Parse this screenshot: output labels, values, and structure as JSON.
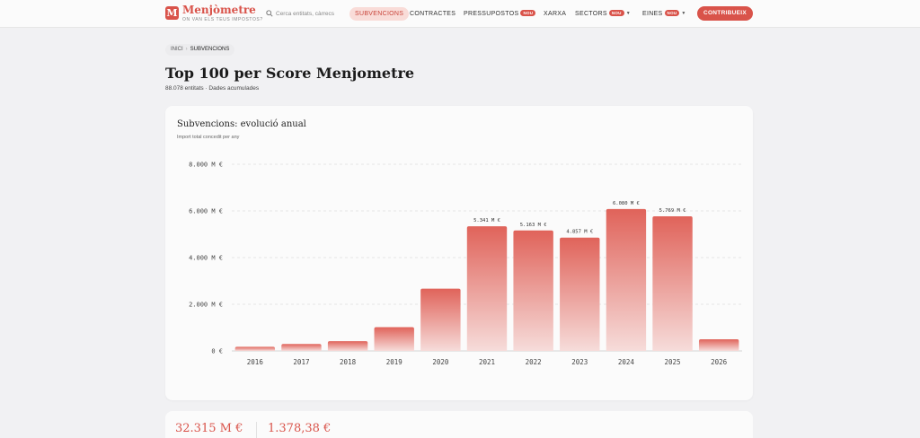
{
  "header": {
    "logo_letter": "M",
    "brand": "Menjòmetre",
    "tagline": "ON VAN ELS TEUS IMPOSTOS?",
    "search_placeholder": "Cerca entitats, càrrecs",
    "nav": [
      {
        "label": "SUBVENCIONS",
        "badge": "",
        "active": true
      },
      {
        "label": "CONTRACTES",
        "badge": ""
      },
      {
        "label": "PRESSUPOSTOS",
        "badge": "NOU"
      },
      {
        "label": "XARXA",
        "badge": ""
      },
      {
        "label": "SECTORS",
        "badge": "NOU",
        "dropdown": true
      },
      {
        "label": "EINES",
        "badge": "NOU",
        "dropdown": true
      }
    ],
    "cta": "CONTRIBUEIX"
  },
  "breadcrumb": {
    "home": "INICI",
    "current": "SUBVENCIONS"
  },
  "page": {
    "title": "Top 100 per Score Menjometre",
    "subtitle": "88.078 entitats · Dades acumulades"
  },
  "chart_card": {
    "title": "Subvencions: evolució anual",
    "subtitle": "Import total concedit per any"
  },
  "chart_data": {
    "type": "bar",
    "title": "Subvencions: evolució anual",
    "subtitle": "Import total concedit per any",
    "categories": [
      "2016",
      "2017",
      "2018",
      "2019",
      "2020",
      "2021",
      "2022",
      "2023",
      "2024",
      "2025",
      "2026"
    ],
    "values": [
      180,
      300,
      420,
      1020,
      2670,
      5341,
      5163,
      4857,
      6080,
      5769,
      500
    ],
    "data_labels": [
      "",
      "",
      "",
      "",
      "",
      "5.341 M €",
      "5.163 M €",
      "4.857 M €",
      "6.080 M €",
      "5.769 M €",
      ""
    ],
    "y_ticks": [
      0,
      2000,
      4000,
      6000,
      8000
    ],
    "y_tick_labels": [
      "0 €",
      "2.000 M €",
      "4.000 M €",
      "6.000 M €",
      "8.000 M €"
    ],
    "ylim": [
      0,
      8000
    ],
    "xlabel": "",
    "ylabel": "",
    "grid": true,
    "colors": {
      "bar_top": "#e0635a",
      "bar_bottom": "#f6dcda",
      "grid": "#e4e4e4",
      "tick_text": "#444444",
      "label_text": "#333333"
    }
  },
  "stats": [
    {
      "value": "32.315 M €"
    },
    {
      "value": "1.378,38 €"
    }
  ]
}
